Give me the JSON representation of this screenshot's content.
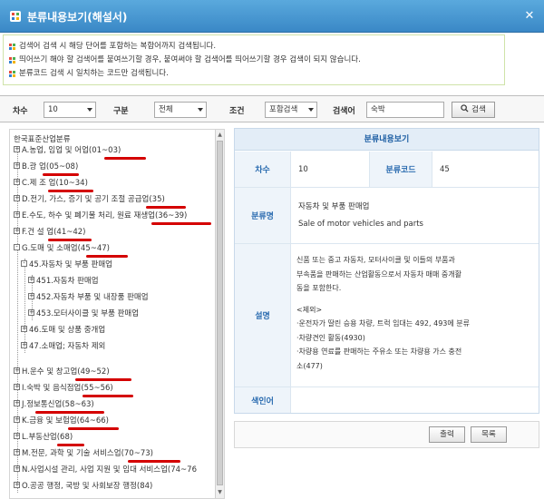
{
  "window": {
    "title": "분류내용보기(해설서)"
  },
  "notice": [
    "검색어 검색 시 해당 단어를 포함하는 복합어까지 검색됩니다.",
    "띄어쓰기 해야 할 검색어를 붙여쓰기할 경우, 붙여써야 할 검색어를 띄어쓰기할 경우 검색이 되지 않습니다.",
    "분류코드 검색 시 일치하는 코드만 검색됩니다."
  ],
  "search": {
    "degree_label": "차수",
    "degree_value": "10",
    "division_label": "구분",
    "division_value": "전체",
    "condition_label": "조건",
    "condition_value": "포함검색",
    "keyword_label": "검색어",
    "keyword_value": "숙박",
    "search_button": "검색"
  },
  "tree": {
    "root": "한국표준산업분류",
    "nodes": [
      {
        "label": "A.농업, 임업 및 어업(01~03)",
        "toggle": "+"
      },
      {
        "label": "B.광 업(05~08)",
        "toggle": "+"
      },
      {
        "label": "C.제 조 업(10~34)",
        "toggle": "+"
      },
      {
        "label": "D.전기, 가스, 증기 및 공기 조절 공급업(35)",
        "toggle": "+"
      },
      {
        "label": "E.수도, 하수 및 폐기물 처리, 원료 재생업(36~39)",
        "toggle": "+"
      },
      {
        "label": "F.건 설 업(41~42)",
        "toggle": "+"
      },
      {
        "label": "G.도매 및 소매업(45~47)",
        "toggle": "-"
      },
      {
        "label": "45.자동차 및 부품 판매업",
        "toggle": "-"
      },
      {
        "label": "451.자동차 판매업",
        "toggle": "+"
      },
      {
        "label": "452.자동차 부품 및 내장품 판매업",
        "toggle": "+"
      },
      {
        "label": "453.모터사이클 및 부품 판매업",
        "toggle": "+"
      },
      {
        "label": "46.도매 및 상품 중개업",
        "toggle": "+"
      },
      {
        "label": "47.소매업; 자동차 제외",
        "toggle": "+"
      },
      {
        "label": "H.운수 및 창고업(49~52)",
        "toggle": "+"
      },
      {
        "label": "I.숙박 및 음식점업(55~56)",
        "toggle": "+"
      },
      {
        "label": "J.정보통신업(58~63)",
        "toggle": "+"
      },
      {
        "label": "K.금융 및 보험업(64~66)",
        "toggle": "+"
      },
      {
        "label": "L.부동산업(68)",
        "toggle": "+"
      },
      {
        "label": "M.전문, 과학 및 기술 서비스업(70~73)",
        "toggle": "+"
      },
      {
        "label": "N.사업시설 관리, 사업 지원 및 임대 서비스업(74~76",
        "toggle": "+"
      },
      {
        "label": "O.공공 행정, 국방 및 사회보장 행정(84)",
        "toggle": "+"
      }
    ]
  },
  "detail": {
    "header": "분류내용보기",
    "degree_label": "차수",
    "degree_value": "10",
    "code_label": "분류코드",
    "code_value": "45",
    "name_label": "분류명",
    "name_ko": "자동차 및 부품 판매업",
    "name_en": "Sale of motor vehicles and parts",
    "desc_label": "설명",
    "desc_lines": [
      "신품 또는 중고 자동차, 모터사이클 및 이들의 부품과",
      "부속품을 판매하는 산업활동으로서 자동차 매매 중개활",
      "동을 포함한다.",
      "",
      "<제외>",
      "·운전자가 딸린 승용 차량, 트럭 임대는 492, 493에 분류",
      "·차량견인 활동(4930)",
      "·차량용 연료를 판매하는 주유소 또는 차량용 가스 충전",
      "소(477)"
    ],
    "index_label": "색인어",
    "index_value": ""
  },
  "buttons": {
    "print": "출력",
    "list": "목록"
  },
  "colors": {
    "title_bar": "#3a88c6",
    "accent": "#1c5ea3",
    "underline": "#d40000"
  }
}
